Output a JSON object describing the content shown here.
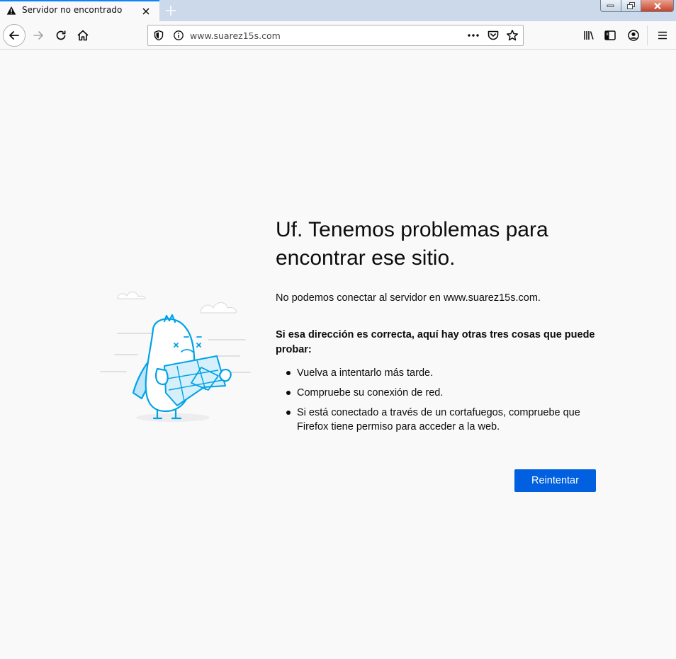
{
  "tab": {
    "title": "Servidor no encontrado",
    "warning_icon": "warning-icon",
    "close_icon": "close-icon",
    "new_tab_icon": "plus-icon"
  },
  "window_controls": [
    "minimize-icon",
    "restore-icon",
    "close-icon"
  ],
  "navigation": {
    "icons": [
      "back-arrow-icon",
      "forward-arrow-icon",
      "reload-icon",
      "home-icon"
    ]
  },
  "urlbar": {
    "url": "www.suarez15s.com",
    "icons": [
      "shield-icon",
      "info-icon",
      "more-icon",
      "pocket-icon",
      "star-icon"
    ]
  },
  "toolbar_icons": [
    "library-icon",
    "sidebar-icon",
    "account-icon",
    "menu-icon"
  ],
  "error": {
    "title": "Uf. Tenemos problemas para encontrar ese sitio.",
    "description": "No podemos conectar al servidor en www.suarez15s.com.",
    "suggestions_heading": "Si esa dirección es correcta, aquí hay otras tres cosas que puede probar:",
    "suggestions": [
      "Vuelva a intentarlo más tarde.",
      "Compruebe su conexión de red.",
      "Si está conectado a través de un cortafuegos, compruebe que Firefox tiene permiso para acceder a la web."
    ],
    "retry_label": "Reintentar"
  },
  "colors": {
    "accent": "#0a84ff",
    "button": "#0060df",
    "illustration": "#00a2e7",
    "page_background": "#f9f9fa",
    "titlebar": "#cbd9ea"
  }
}
